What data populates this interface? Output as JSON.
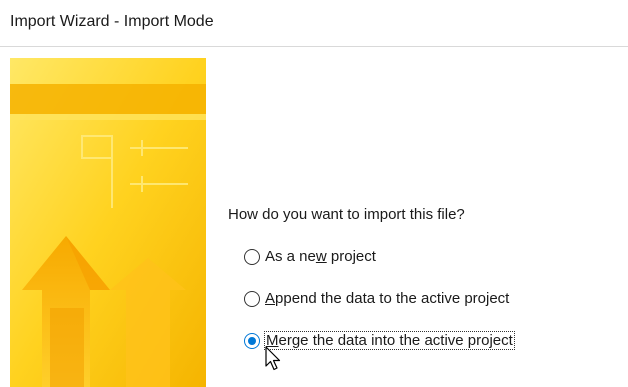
{
  "window": {
    "title": "Import Wizard - Import Mode"
  },
  "main": {
    "question": "How do you want to import this file?",
    "options": [
      {
        "pre": "As a ne",
        "mnemonic": "w",
        "post": " project",
        "selected": false
      },
      {
        "pre": "",
        "mnemonic": "A",
        "post": "ppend the data to the active project",
        "selected": false
      },
      {
        "pre": "",
        "mnemonic": "M",
        "post": "erge the data into the active project",
        "selected": true
      }
    ]
  },
  "colors": {
    "accent": "#0078d7",
    "banner_light": "#ffe15a",
    "banner_dark": "#f3a800"
  },
  "icons": {
    "cursor": "mouse-pointer-icon",
    "banner": "import-arrow-graphic"
  }
}
